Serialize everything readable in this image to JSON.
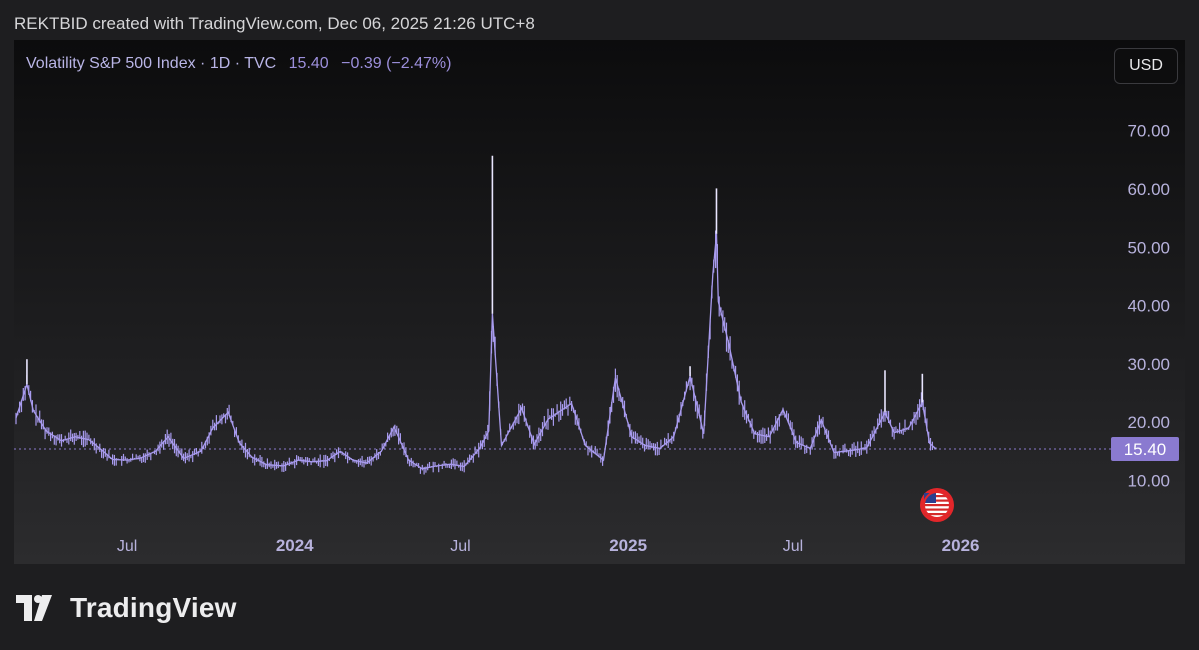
{
  "header": {
    "attribution": "REKTBID created with TradingView.com, Dec 06, 2025 21:26 UTC+8"
  },
  "legend": {
    "symbol": "Volatility S&P 500 Index · 1D · TVC",
    "price": "15.40",
    "change": "−0.39 (−2.47%)"
  },
  "currency_button": "USD",
  "brand": {
    "name": "TradingView"
  },
  "colors": {
    "series": "#a89bee",
    "background": "#1e1e20",
    "badge": "#8a7ad0"
  },
  "chart_data": {
    "type": "line",
    "title": "Volatility S&P 500 Index · 1D · TVC",
    "x_tick_labels": [
      "Jul",
      "2024",
      "Jul",
      "2025",
      "Jul",
      "2026"
    ],
    "y_tick_labels": [
      "70.00",
      "60.00",
      "50.00",
      "40.00",
      "30.00",
      "20.00",
      "10.00"
    ],
    "ylim": [
      3,
      80
    ],
    "last_value": 15.4,
    "last_value_label": "15.40",
    "grid": false,
    "series": [
      {
        "points": [
          [
            "2023-03-01",
            20.7
          ],
          [
            "2023-03-13",
            26.5
          ],
          [
            "2023-03-20",
            22.0
          ],
          [
            "2023-04-03",
            18.5
          ],
          [
            "2023-04-20",
            16.8
          ],
          [
            "2023-05-05",
            17.5
          ],
          [
            "2023-05-20",
            17.0
          ],
          [
            "2023-06-01",
            15.5
          ],
          [
            "2023-06-15",
            13.6
          ],
          [
            "2023-07-01",
            13.5
          ],
          [
            "2023-07-15",
            13.8
          ],
          [
            "2023-08-01",
            15.0
          ],
          [
            "2023-08-15",
            17.5
          ],
          [
            "2023-09-01",
            13.8
          ],
          [
            "2023-09-20",
            15.0
          ],
          [
            "2023-10-03",
            19.0
          ],
          [
            "2023-10-20",
            21.7
          ],
          [
            "2023-11-01",
            16.5
          ],
          [
            "2023-11-15",
            14.0
          ],
          [
            "2023-12-01",
            12.7
          ],
          [
            "2023-12-20",
            12.5
          ],
          [
            "2024-01-05",
            13.5
          ],
          [
            "2024-01-20",
            13.2
          ],
          [
            "2024-02-05",
            13.4
          ],
          [
            "2024-02-20",
            15.0
          ],
          [
            "2024-03-05",
            13.5
          ],
          [
            "2024-03-20",
            13.0
          ],
          [
            "2024-04-05",
            15.0
          ],
          [
            "2024-04-19",
            19.2
          ],
          [
            "2024-05-05",
            13.5
          ],
          [
            "2024-05-20",
            12.0
          ],
          [
            "2024-06-05",
            12.5
          ],
          [
            "2024-06-20",
            12.8
          ],
          [
            "2024-07-05",
            12.4
          ],
          [
            "2024-07-22",
            15.5
          ],
          [
            "2024-08-01",
            18.5
          ],
          [
            "2024-08-05",
            38.6
          ],
          [
            "2024-08-15",
            16.0
          ],
          [
            "2024-09-06",
            22.4
          ],
          [
            "2024-09-20",
            16.2
          ],
          [
            "2024-10-05",
            20.5
          ],
          [
            "2024-10-31",
            23.2
          ],
          [
            "2024-11-15",
            16.0
          ],
          [
            "2024-12-05",
            13.5
          ],
          [
            "2024-12-18",
            27.6
          ],
          [
            "2025-01-05",
            17.5
          ],
          [
            "2025-01-20",
            16.0
          ],
          [
            "2025-02-05",
            15.5
          ],
          [
            "2025-02-20",
            17.5
          ],
          [
            "2025-03-10",
            27.9
          ],
          [
            "2025-03-25",
            18.0
          ],
          [
            "2025-04-04",
            45.3
          ],
          [
            "2025-04-08",
            52.3
          ],
          [
            "2025-04-10",
            40.7
          ],
          [
            "2025-04-21",
            33.8
          ],
          [
            "2025-05-05",
            23.5
          ],
          [
            "2025-05-20",
            18.0
          ],
          [
            "2025-06-05",
            17.5
          ],
          [
            "2025-06-20",
            22.2
          ],
          [
            "2025-07-05",
            16.5
          ],
          [
            "2025-07-20",
            15.5
          ],
          [
            "2025-08-01",
            20.4
          ],
          [
            "2025-08-15",
            14.8
          ],
          [
            "2025-09-05",
            15.2
          ],
          [
            "2025-09-20",
            15.6
          ],
          [
            "2025-10-10",
            21.7
          ],
          [
            "2025-10-20",
            18.2
          ],
          [
            "2025-11-05",
            19.0
          ],
          [
            "2025-11-20",
            23.4
          ],
          [
            "2025-11-28",
            16.4
          ],
          [
            "2025-12-05",
            15.4
          ]
        ],
        "spikes": [
          [
            "2023-03-13",
            26.5,
            30.8
          ],
          [
            "2024-08-05",
            38.6,
            65.7
          ],
          [
            "2024-12-18",
            27.6,
            27.6
          ],
          [
            "2025-03-10",
            27.9,
            29.6
          ],
          [
            "2025-04-08",
            52.3,
            60.1
          ],
          [
            "2025-10-10",
            21.7,
            28.9
          ],
          [
            "2025-11-20",
            23.4,
            28.3
          ]
        ]
      }
    ]
  }
}
